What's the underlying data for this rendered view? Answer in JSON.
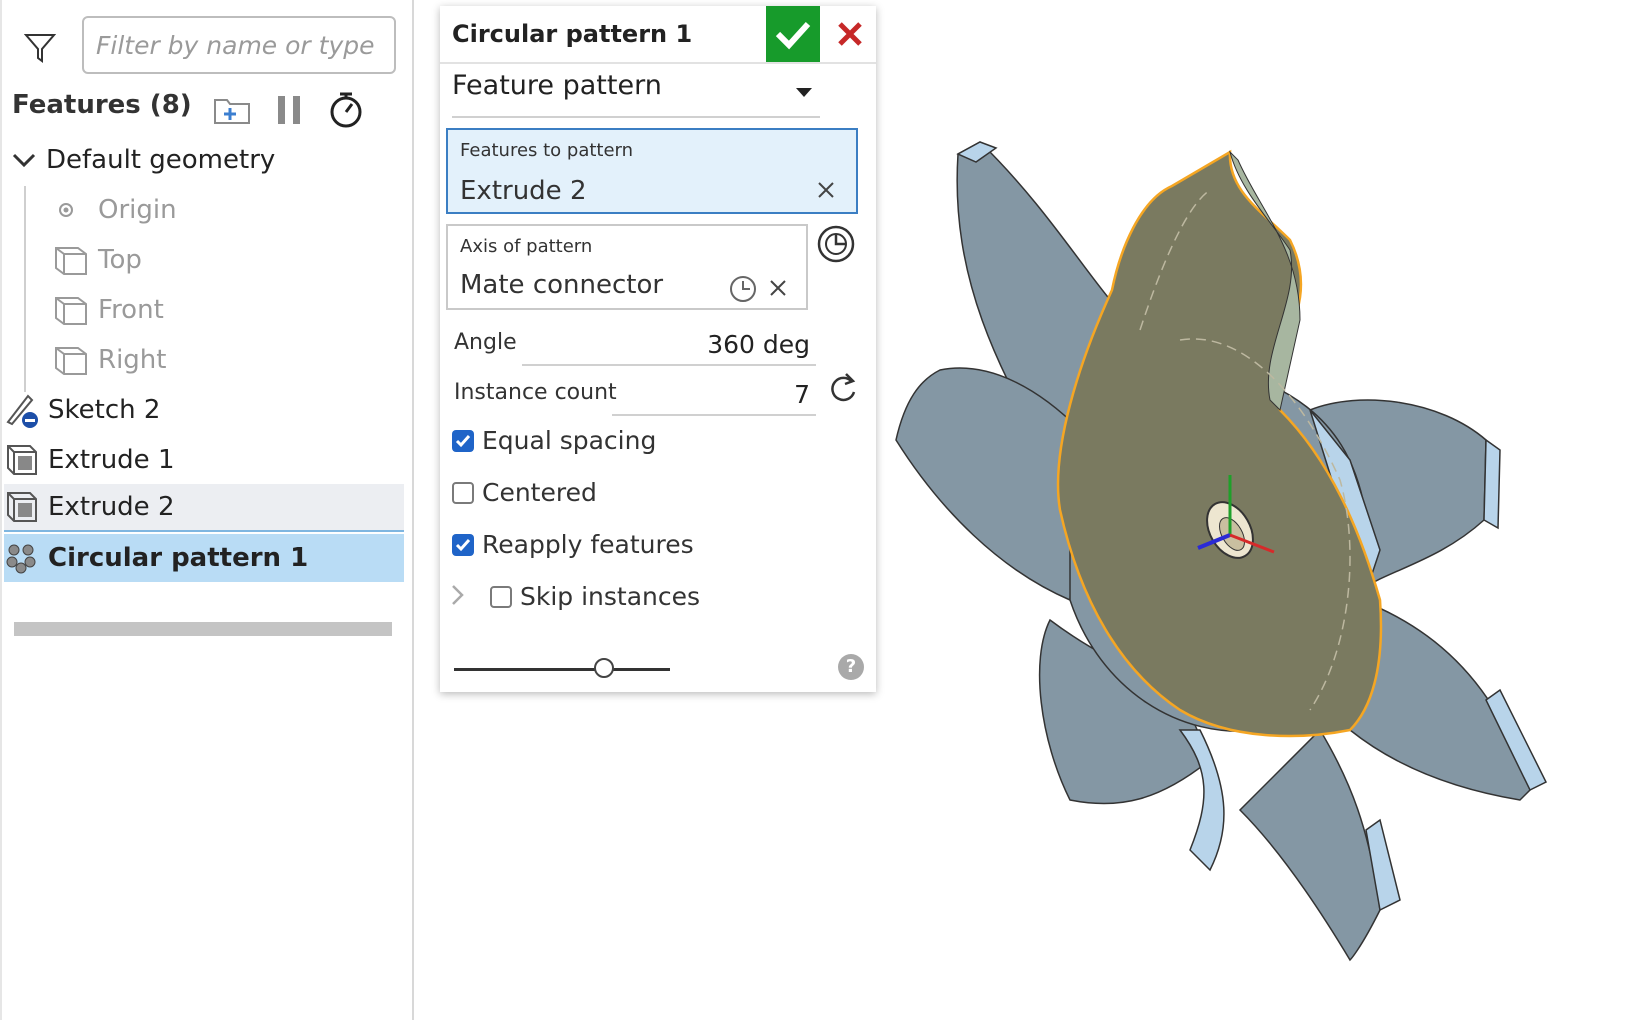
{
  "tree": {
    "filter_placeholder": "Filter by name or type",
    "header": "Features (8)",
    "default_geometry": "Default geometry",
    "planes": [
      {
        "label": "Origin",
        "icon": "origin-icon"
      },
      {
        "label": "Top",
        "icon": "plane-icon"
      },
      {
        "label": "Front",
        "icon": "plane-icon"
      },
      {
        "label": "Right",
        "icon": "plane-icon"
      }
    ],
    "features": [
      {
        "label": "Sketch 2",
        "icon": "sketch-icon"
      },
      {
        "label": "Extrude 1",
        "icon": "extrude-icon"
      },
      {
        "label": "Extrude 2",
        "icon": "extrude-icon"
      },
      {
        "label": "Circular pattern 1",
        "icon": "circular-pattern-icon"
      }
    ]
  },
  "dialog": {
    "title": "Circular pattern 1",
    "pattern_type": "Feature pattern",
    "features_field": {
      "label": "Features to pattern",
      "value": "Extrude 2"
    },
    "axis_field": {
      "label": "Axis of pattern",
      "value": "Mate connector"
    },
    "angle": {
      "label": "Angle",
      "value": "360 deg"
    },
    "instance_count": {
      "label": "Instance count",
      "value": "7"
    },
    "options": [
      {
        "label": "Equal spacing",
        "checked": true
      },
      {
        "label": "Centered",
        "checked": false
      },
      {
        "label": "Reapply features",
        "checked": true
      },
      {
        "label": "Skip instances",
        "checked": false
      }
    ],
    "help": "?",
    "colors": {
      "ok": "#179b2b",
      "cancel": "#c62828",
      "active_field": "#e3f1fb",
      "selected_row": "#b9dcf5"
    }
  },
  "viewport": {
    "part_color": "#8497a4",
    "side_color": "#b8d4ea",
    "highlight_color": "#f5a623",
    "selected_face_color": "#7a7a60"
  }
}
